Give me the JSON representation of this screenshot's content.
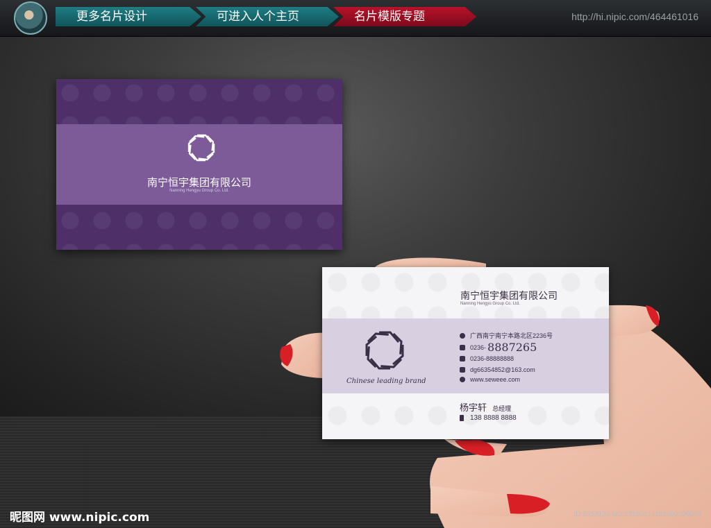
{
  "nav": {
    "item1": "更多名片设计",
    "item2": "可进入人个主页",
    "item3": "名片模版专题",
    "site_url": "http://hi.nipic.com/464461016"
  },
  "back_card": {
    "company": "南宁恒宇集团有限公司",
    "company_en": "Nanning Hengyu Group Co. Ltd."
  },
  "front_card": {
    "company": "南宁恒宇集团有限公司",
    "company_en": "Nanning Hengyu Group Co. Ltd.",
    "slogan": "Chinese leading brand",
    "address": "广西南宁南宁本路北区2236号",
    "phone_prefix": "0236-",
    "phone_main": "8887265",
    "fax": "0236-88888888",
    "email": "dg66354852@163.com",
    "website": "www.seweee.com",
    "person_name": "杨宇轩",
    "person_title": "总经理",
    "mobile": "138 8888 8888"
  },
  "watermark": {
    "left": "昵图网 www.nipic.com",
    "right": "ID:9353120 NO:20150514152609350036"
  },
  "colors": {
    "nav_teal": "#1f7c83",
    "nav_red": "#b8122a",
    "card_purple": "#4e2f68",
    "band_purple": "#7d5a98",
    "band_light": "#d8d0e0"
  }
}
